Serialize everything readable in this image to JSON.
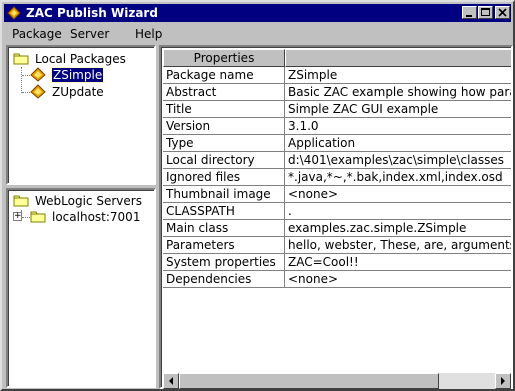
{
  "window": {
    "title": "ZAC Publish Wizard"
  },
  "menu": [
    "Package",
    "Server",
    "Help"
  ],
  "local_tree": {
    "root": "Local Packages",
    "items": [
      {
        "label": "ZSimple",
        "selected": true
      },
      {
        "label": "ZUpdate",
        "selected": false
      }
    ]
  },
  "server_tree": {
    "root": "WebLogic Servers",
    "items": [
      {
        "label": "localhost:7001",
        "collapsed": true
      }
    ]
  },
  "table": {
    "headers": [
      "Properties",
      ""
    ],
    "rows": [
      [
        "Package name",
        "ZSimple"
      ],
      [
        "Abstract",
        "Basic ZAC example showing how para..."
      ],
      [
        "Title",
        "Simple ZAC GUI example"
      ],
      [
        "Version",
        "3.1.0"
      ],
      [
        "Type",
        "Application"
      ],
      [
        "Local directory",
        "d:\\401\\examples\\zac\\simple\\classes"
      ],
      [
        "Ignored files",
        "*.java,*~,*.bak,index.xml,index.osd"
      ],
      [
        "Thumbnail image",
        "<none>"
      ],
      [
        "CLASSPATH",
        "."
      ],
      [
        "Main class",
        "examples.zac.simple.ZSimple"
      ],
      [
        "Parameters",
        "hello, webster, These, are, arguments, ..."
      ],
      [
        "System properties",
        "ZAC=Cool!!"
      ],
      [
        "Dependencies",
        "<none>"
      ]
    ]
  },
  "icons": {
    "app": "app-logo-icon",
    "folder": "folder-icon",
    "package": "package-icon",
    "expand": "plus-expander-icon"
  },
  "colors": {
    "titlebar": "#000080",
    "face": "#c0c0c0",
    "selection": "#000080"
  }
}
